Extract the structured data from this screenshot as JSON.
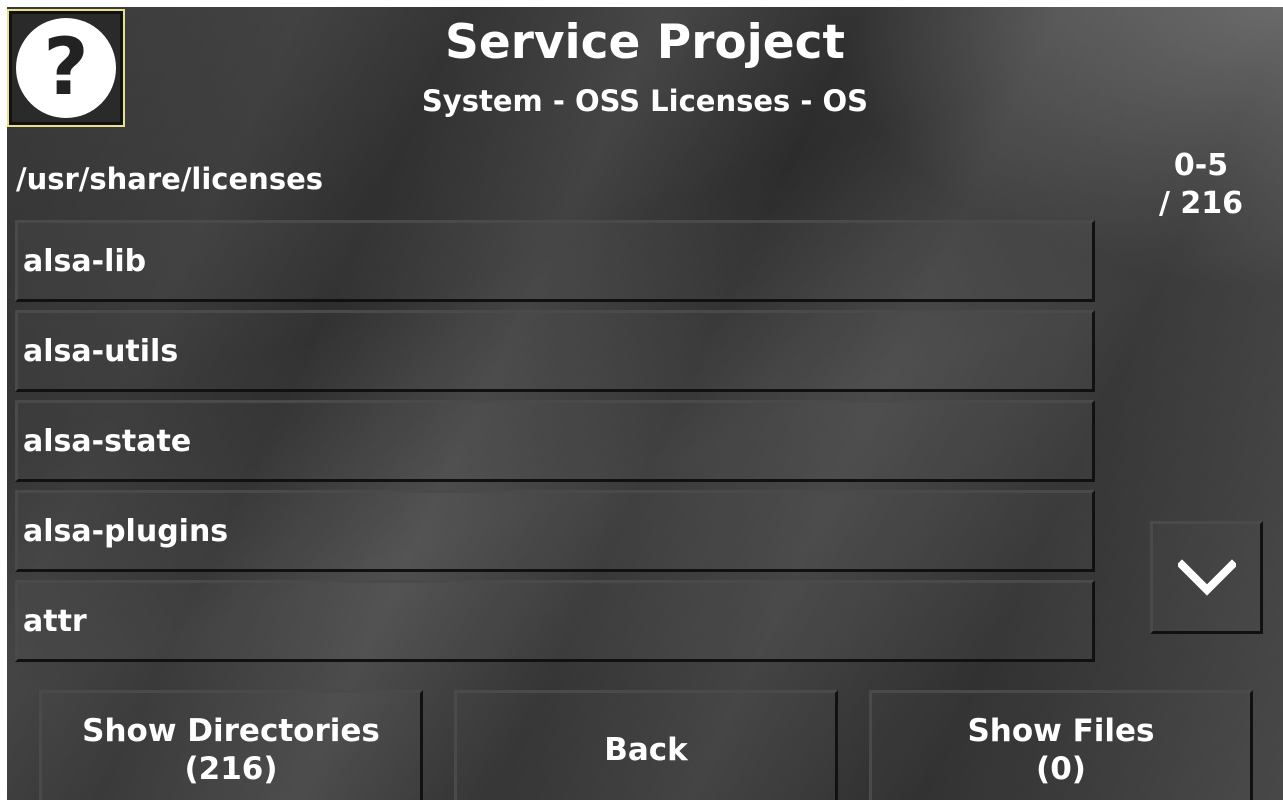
{
  "header": {
    "help_icon_glyph": "?",
    "title": "Service Project",
    "subtitle": "System - OSS Licenses - OS"
  },
  "browser": {
    "path": "/usr/share/licenses",
    "range_line1": "0-5",
    "range_line2": "/ 216",
    "items": [
      {
        "label": "alsa-lib"
      },
      {
        "label": "alsa-utils"
      },
      {
        "label": "alsa-state"
      },
      {
        "label": "alsa-plugins"
      },
      {
        "label": "attr"
      }
    ],
    "scroll_down_icon": "chevron-down-icon"
  },
  "footer": {
    "show_directories_label": "Show Directories",
    "show_directories_count": "(216)",
    "back_label": "Back",
    "show_files_label": "Show Files",
    "show_files_count": "(0)"
  },
  "colors": {
    "background": "#333333",
    "text": "#ffffff",
    "help_border": "#e8e08a"
  }
}
